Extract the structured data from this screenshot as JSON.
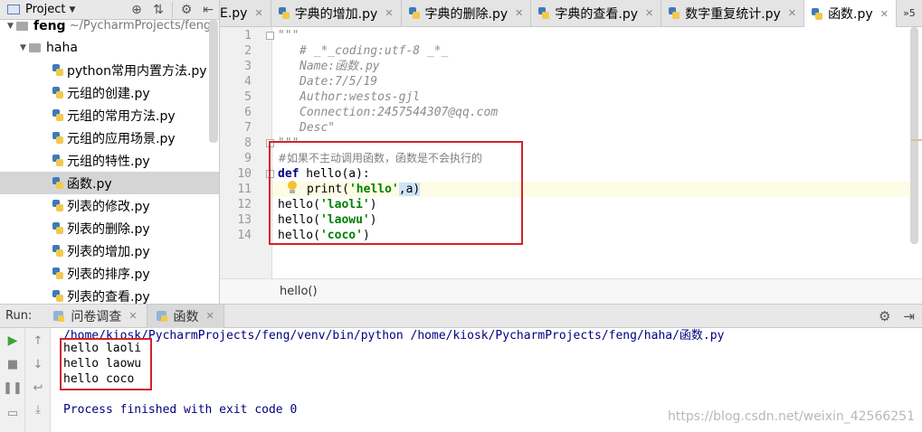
{
  "project_panel": {
    "title": "Project",
    "tree": [
      {
        "label": "feng",
        "path": "~/PycharmProjects/feng",
        "kind": "folder",
        "expanded": true
      },
      {
        "label": "haha",
        "kind": "folder",
        "expanded": true
      },
      {
        "label": "python常用内置方法.py",
        "kind": "file"
      },
      {
        "label": "元组的创建.py",
        "kind": "file"
      },
      {
        "label": "元组的常用方法.py",
        "kind": "file"
      },
      {
        "label": "元组的应用场景.py",
        "kind": "file"
      },
      {
        "label": "元组的特性.py",
        "kind": "file"
      },
      {
        "label": "函数.py",
        "kind": "file",
        "selected": true
      },
      {
        "label": "列表的修改.py",
        "kind": "file"
      },
      {
        "label": "列表的删除.py",
        "kind": "file"
      },
      {
        "label": "列表的增加.py",
        "kind": "file"
      },
      {
        "label": "列表的排序.py",
        "kind": "file"
      },
      {
        "label": "列表的查看.py",
        "kind": "file"
      }
    ]
  },
  "editor_tabs": {
    "tabs": [
      {
        "label": "E.py"
      },
      {
        "label": "字典的增加.py"
      },
      {
        "label": "字典的删除.py"
      },
      {
        "label": "字典的查看.py"
      },
      {
        "label": "数字重复统计.py"
      },
      {
        "label": "函数.py",
        "active": true
      }
    ],
    "overflow": "»5"
  },
  "editor": {
    "line_numbers": [
      "1",
      "2",
      "3",
      "4",
      "5",
      "6",
      "7",
      "8",
      "9",
      "10",
      "11",
      "12",
      "13",
      "14"
    ],
    "docstring": {
      "open": "\"\"\"",
      "coding": "# _*_coding:utf-8 _*_",
      "name": "Name:函数.py",
      "date": "Date:7/5/19",
      "author": "Author:westos-gjl",
      "connection": "Connection:2457544307@qq.com",
      "desc": "Desc\"",
      "close": "\"\"\""
    },
    "comment": "#如果不主动调用函数，函数是不会执行的",
    "def_kw": "def",
    "def_rest": " hello(a):",
    "print_call": "print(",
    "print_arg": "'hello'",
    "print_rest": ",a)",
    "calls": [
      {
        "fn": "hello(",
        "arg": "'laoli'",
        "close": ")"
      },
      {
        "fn": "hello(",
        "arg": "'laowu'",
        "close": ")"
      },
      {
        "fn": "hello(",
        "arg": "'coco'",
        "close": ")"
      }
    ],
    "breadcrumb": "hello()"
  },
  "run_panel": {
    "label": "Run:",
    "tabs": [
      {
        "label": "问卷调查"
      },
      {
        "label": "函数",
        "active": true
      }
    ],
    "console": {
      "command": "/home/kiosk/PycharmProjects/feng/venv/bin/python /home/kiosk/PycharmProjects/feng/haha/函数.py",
      "output": [
        "hello laoli",
        "hello laowu",
        "hello coco"
      ],
      "finished": "Process finished with exit code 0"
    },
    "watermark": "https://blog.csdn.net/weixin_42566251"
  },
  "colors": {
    "highlight_box": "#d4232b",
    "keyword": "#000080",
    "string": "#008000",
    "docstring": "#8c8c8c"
  }
}
